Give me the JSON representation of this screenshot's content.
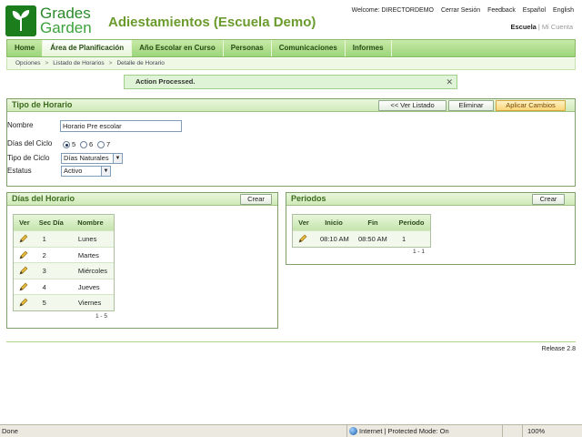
{
  "header": {
    "logo_line1": "Grades",
    "logo_line2": "Garden",
    "title": "Adiestamientos (Escuela Demo)",
    "welcome": "Welcome: DIRECTORDEMO",
    "logout": "Cerrar Sesión",
    "feedback": "Feedback",
    "lang_es": "Español",
    "lang_en": "English",
    "school": "Escuela",
    "separator": "|",
    "my_account": "Mi Cuenta"
  },
  "nav": {
    "tabs": [
      "Home",
      "Área de Planificación",
      "Año Escolar en Curso",
      "Personas",
      "Comunicaciones",
      "Informes"
    ],
    "active_index": 1
  },
  "breadcrumb": [
    "Opciones",
    "Listado de Horarios",
    "Detalle de Horario"
  ],
  "message": {
    "text": "Action Processed.",
    "close": "✕"
  },
  "tipo": {
    "title": "Tipo de Horario",
    "btn_list": "<< Ver Listado",
    "btn_delete": "Eliminar",
    "btn_apply": "Aplicar Cambios",
    "nombre_label": "Nombre",
    "nombre_value": "Horario Pre escolar",
    "dias_label": "Días del Ciclo",
    "dias_options": [
      "5",
      "6",
      "7"
    ],
    "dias_selected": "5",
    "ciclo_label": "Tipo de Ciclo",
    "ciclo_value": "Días Naturales",
    "estatus_label": "Estatus",
    "estatus_value": "Activo"
  },
  "dias": {
    "title": "Días del Horario",
    "create": "Crear",
    "columns": [
      "Ver",
      "Sec Día",
      "Nombre"
    ],
    "rows": [
      {
        "sec": "1",
        "nombre": "Lunes"
      },
      {
        "sec": "2",
        "nombre": "Martes"
      },
      {
        "sec": "3",
        "nombre": "Miércoles"
      },
      {
        "sec": "4",
        "nombre": "Jueves"
      },
      {
        "sec": "5",
        "nombre": "Viernes"
      }
    ],
    "pager": "1 - 5"
  },
  "periodos": {
    "title": "Periodos",
    "create": "Crear",
    "columns": [
      "Ver",
      "Inicio",
      "Fin",
      "Periodo"
    ],
    "rows": [
      {
        "inicio": "08:10 AM",
        "fin": "08:50 AM",
        "periodo": "1"
      }
    ],
    "pager": "1 - 1"
  },
  "footer": {
    "release": "Release 2.8"
  },
  "statusbar": {
    "left": "Done",
    "zone": "Internet | Protected Mode: On",
    "zoom": "100%"
  },
  "colors": {
    "brand_green": "#2a8a2a",
    "nav_green": "#9cd57a",
    "apply_orange": "#f9d577"
  }
}
